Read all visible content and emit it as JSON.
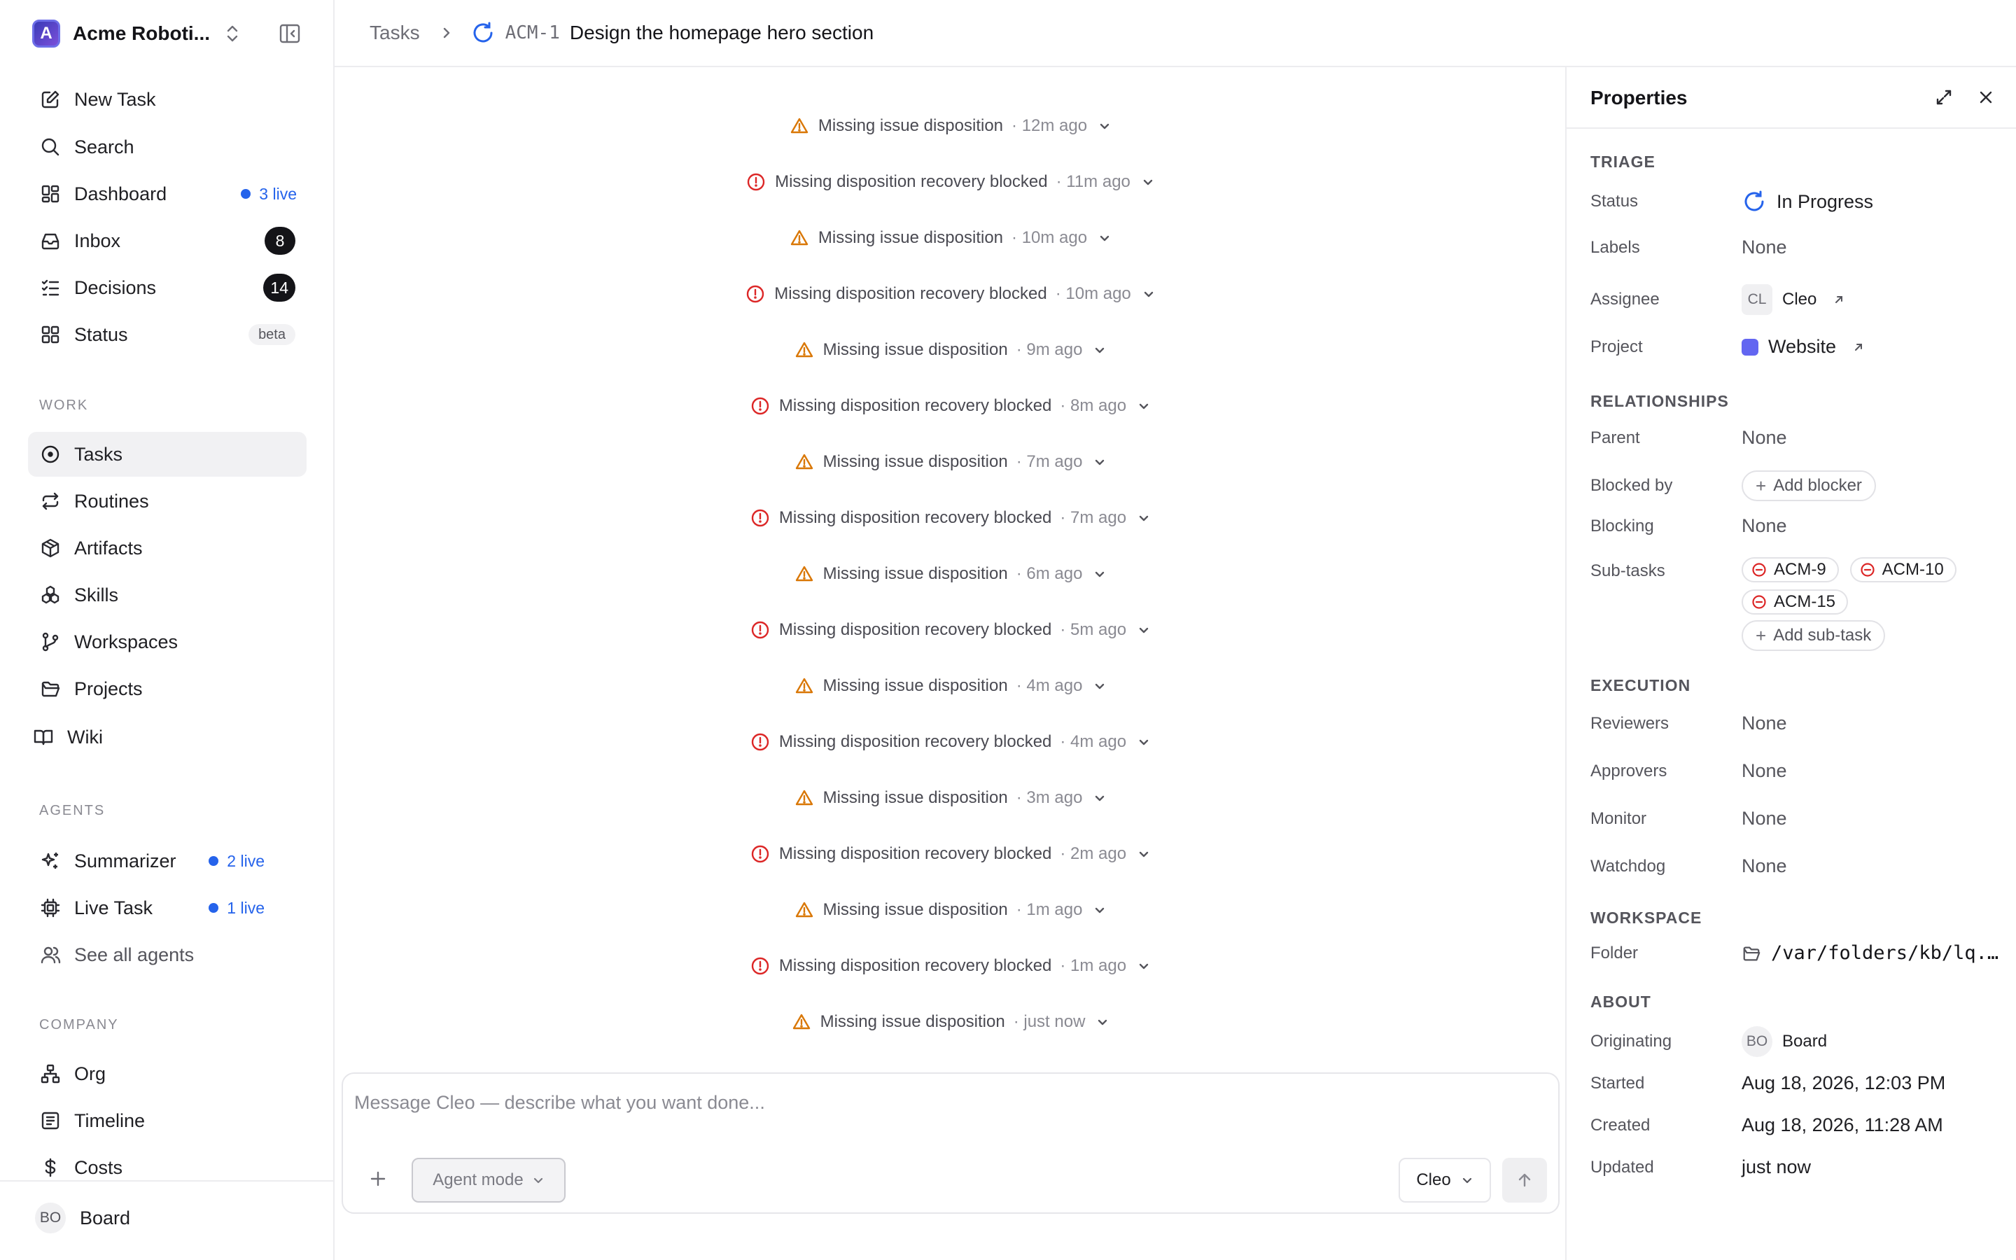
{
  "workspace": {
    "name": "Acme Roboti...",
    "logo_letter": "A"
  },
  "nav": {
    "new_task": "New Task",
    "search": "Search",
    "dashboard": "Dashboard",
    "dashboard_live": "3 live",
    "inbox": "Inbox",
    "inbox_count": "8",
    "decisions": "Decisions",
    "decisions_count": "14",
    "status": "Status",
    "status_badge": "beta"
  },
  "work": {
    "label": "WORK",
    "items": [
      "Tasks",
      "Routines",
      "Artifacts",
      "Skills",
      "Workspaces",
      "Projects",
      "Wiki"
    ]
  },
  "agents": {
    "label": "AGENTS",
    "summarizer": "Summarizer",
    "summarizer_live": "2 live",
    "live_task": "Live Task",
    "live_task_live": "1 live",
    "see_all": "See all agents"
  },
  "company": {
    "label": "COMPANY",
    "items": [
      "Org",
      "Timeline",
      "Costs"
    ]
  },
  "footer": {
    "initials": "BO",
    "name": "Board"
  },
  "breadcrumb": {
    "root": "Tasks",
    "task_id": "ACM-1",
    "task_title": "Design the homepage hero section"
  },
  "events": [
    {
      "kind": "warning",
      "text": "Missing issue disposition",
      "time": "· 12m ago"
    },
    {
      "kind": "error",
      "text": "Missing disposition recovery blocked",
      "time": "· 11m ago"
    },
    {
      "kind": "warning",
      "text": "Missing issue disposition",
      "time": "· 10m ago"
    },
    {
      "kind": "error",
      "text": "Missing disposition recovery blocked",
      "time": "· 10m ago"
    },
    {
      "kind": "warning",
      "text": "Missing issue disposition",
      "time": "· 9m ago"
    },
    {
      "kind": "error",
      "text": "Missing disposition recovery blocked",
      "time": "· 8m ago"
    },
    {
      "kind": "warning",
      "text": "Missing issue disposition",
      "time": "· 7m ago"
    },
    {
      "kind": "error",
      "text": "Missing disposition recovery blocked",
      "time": "· 7m ago"
    },
    {
      "kind": "warning",
      "text": "Missing issue disposition",
      "time": "· 6m ago"
    },
    {
      "kind": "error",
      "text": "Missing disposition recovery blocked",
      "time": "· 5m ago"
    },
    {
      "kind": "warning",
      "text": "Missing issue disposition",
      "time": "· 4m ago"
    },
    {
      "kind": "error",
      "text": "Missing disposition recovery blocked",
      "time": "· 4m ago"
    },
    {
      "kind": "warning",
      "text": "Missing issue disposition",
      "time": "· 3m ago"
    },
    {
      "kind": "error",
      "text": "Missing disposition recovery blocked",
      "time": "· 2m ago"
    },
    {
      "kind": "warning",
      "text": "Missing issue disposition",
      "time": "· 1m ago"
    },
    {
      "kind": "error",
      "text": "Missing disposition recovery blocked",
      "time": "· 1m ago"
    },
    {
      "kind": "warning",
      "text": "Missing issue disposition",
      "time": "· just now"
    }
  ],
  "composer": {
    "placeholder": "Message Cleo — describe what you want done...",
    "mode": "Agent mode",
    "agent": "Cleo"
  },
  "properties": {
    "title": "Properties",
    "triage": {
      "label": "TRIAGE",
      "status_key": "Status",
      "status_val": "In Progress",
      "labels_key": "Labels",
      "labels_val": "None",
      "assignee_key": "Assignee",
      "assignee_initials": "CL",
      "assignee_val": "Cleo",
      "project_key": "Project",
      "project_val": "Website",
      "project_color": "#6366f1"
    },
    "relationships": {
      "label": "RELATIONSHIPS",
      "parent_key": "Parent",
      "parent_val": "None",
      "blocked_by_key": "Blocked by",
      "blocked_by_action": "Add blocker",
      "blocking_key": "Blocking",
      "blocking_val": "None",
      "subtasks_key": "Sub-tasks",
      "subtasks": [
        "ACM-9",
        "ACM-10",
        "ACM-15"
      ],
      "add_subtask": "Add sub-task"
    },
    "execution": {
      "label": "EXECUTION",
      "reviewers_key": "Reviewers",
      "reviewers_val": "None",
      "approvers_key": "Approvers",
      "approvers_val": "None",
      "monitor_key": "Monitor",
      "monitor_val": "None",
      "watchdog_key": "Watchdog",
      "watchdog_val": "None"
    },
    "workspace": {
      "label": "WORKSPACE",
      "folder_key": "Folder",
      "folder_val": "/var/folders/kb/lq..."
    },
    "about": {
      "label": "ABOUT",
      "originating_key": "Originating",
      "originating_initials": "BO",
      "originating_val": "Board",
      "started_key": "Started",
      "started_val": "Aug 18, 2026, 12:03 PM",
      "created_key": "Created",
      "created_val": "Aug 18, 2026, 11:28 AM",
      "updated_key": "Updated",
      "updated_val": "just now"
    }
  },
  "colors": {
    "accent": "#2563eb",
    "warning": "#d97706",
    "error": "#dc2626"
  }
}
